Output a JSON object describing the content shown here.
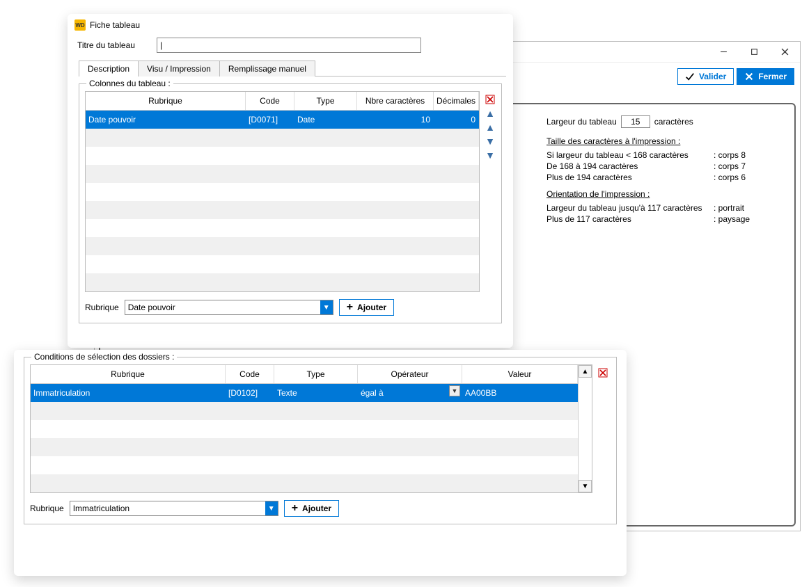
{
  "bgWindow": {
    "valider": "Valider",
    "fermer": "Fermer",
    "largeur_label": "Largeur du tableau",
    "largeur_value": "15",
    "caracteres": "caractères",
    "taille_h": "Taille des caractères à l'impression :",
    "taille_rows": [
      {
        "l": "Si largeur du tableau < 168 caractères",
        "r": ": corps 8"
      },
      {
        "l": "De 168 à 194 caractères",
        "r": ": corps 7"
      },
      {
        "l": "Plus de 194 caractères",
        "r": ": corps 6"
      }
    ],
    "orient_h": "Orientation de  l'impression :",
    "orient_rows": [
      {
        "l": "Largeur du tableau jusqu'à 117 caractères",
        "r": ": portrait"
      },
      {
        "l": "Plus de 117 caractères",
        "r": ": paysage"
      }
    ]
  },
  "fg1": {
    "windowTitle": "Fiche tableau",
    "titre_label": "Titre du tableau",
    "titre_value": "",
    "cursor": "|",
    "tabs": [
      "Description",
      "Visu / Impression",
      "Remplissage manuel"
    ],
    "colonnes_legend": "Colonnes du tableau :",
    "headers": {
      "rub": "Rubrique",
      "code": "Code",
      "type": "Type",
      "nb": "Nbre caractères",
      "dec": "Décimales"
    },
    "row": {
      "rub": "Date pouvoir",
      "code": "[D0071]",
      "type": "Date",
      "nb": "10",
      "dec": "0"
    },
    "rub_label": "Rubrique",
    "rub_combo": "Date pouvoir",
    "ajouter": "Ajouter"
  },
  "fg2": {
    "legend": "Conditions de sélection des dossiers :",
    "headers": {
      "rub": "Rubrique",
      "code": "Code",
      "type": "Type",
      "op": "Opérateur",
      "val": "Valeur"
    },
    "row": {
      "rub": "Immatriculation",
      "code": "[D0102]",
      "type": "Texte",
      "op": "égal à",
      "val": "AA00BB"
    },
    "rub_label": "Rubrique",
    "rub_combo": "Immatriculation",
    "ajouter": "Ajouter"
  }
}
